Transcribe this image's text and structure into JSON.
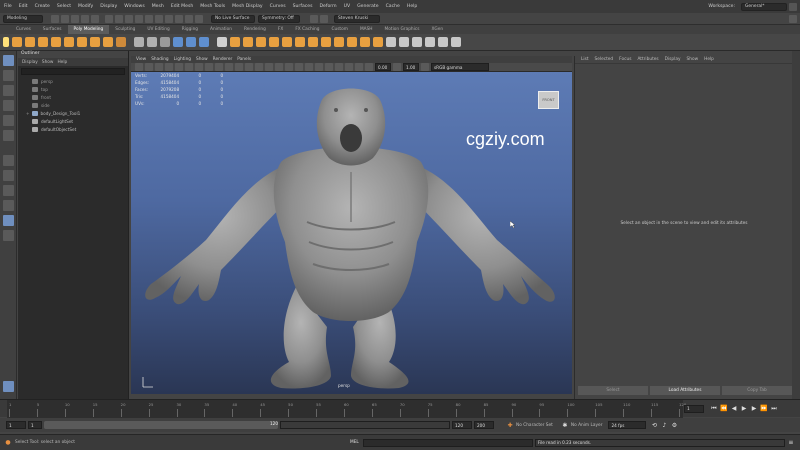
{
  "menubar": {
    "items": [
      "File",
      "Edit",
      "Create",
      "Select",
      "Modify",
      "Display",
      "Windows",
      "Mesh",
      "Edit Mesh",
      "Mesh Tools",
      "Mesh Display",
      "Curves",
      "Surfaces",
      "Deform",
      "UV",
      "Generate",
      "Cache",
      "Help"
    ],
    "workspace_label": "Workspace:",
    "workspace_value": "General*"
  },
  "statusline": {
    "mode": "Modeling",
    "live_surface": "No Live Surface",
    "symmetry": "Symmetry: Off",
    "account": "Steven Kruski"
  },
  "shelf": {
    "tabs": [
      "Curves",
      "Surfaces",
      "Poly Modeling",
      "Sculpting",
      "UV Editing",
      "Rigging",
      "Animation",
      "Rendering",
      "FX",
      "FX Caching",
      "Custom",
      "MASH",
      "Motion Graphics",
      "XGen"
    ],
    "active": "Poly Modeling"
  },
  "outliner": {
    "title": "Outliner",
    "menu": [
      "Display",
      "Show",
      "Help"
    ],
    "items": [
      "persp",
      "top",
      "front",
      "side",
      "body_Design_Tool1",
      "defaultLightSet",
      "defaultObjectSet"
    ]
  },
  "viewport": {
    "menu": [
      "View",
      "Shading",
      "Lighting",
      "Show",
      "Renderer",
      "Panels"
    ],
    "gamma": "0.00",
    "exposure": "1.00",
    "color_space": "sRGB gamma",
    "camera": "persp",
    "watermark": "cgziy.com",
    "viewcube_label": "FRONT",
    "hud": [
      {
        "label": "Verts:",
        "a": "2079404",
        "b": "0",
        "c": "0"
      },
      {
        "label": "Edges:",
        "a": "4158404",
        "b": "0",
        "c": "0"
      },
      {
        "label": "Faces:",
        "a": "2079208",
        "b": "0",
        "c": "0"
      },
      {
        "label": "Tris:",
        "a": "4158404",
        "b": "0",
        "c": "0"
      },
      {
        "label": "UVs:",
        "a": "0",
        "b": "0",
        "c": "0"
      }
    ]
  },
  "attribute_editor": {
    "menu": [
      "List",
      "Selected",
      "Focus",
      "Attributes",
      "Display",
      "Show",
      "Help"
    ],
    "message": "Select an object in the scene to view and edit its attributes",
    "buttons": [
      "Select",
      "Load Attributes",
      "Copy Tab"
    ]
  },
  "timeline": {
    "ticks": [
      "1",
      "5",
      "10",
      "15",
      "20",
      "25",
      "30",
      "35",
      "40",
      "45",
      "50",
      "55",
      "60",
      "65",
      "70",
      "75",
      "80",
      "85",
      "90",
      "95",
      "100",
      "105",
      "110",
      "115",
      "120"
    ],
    "current_frame": "1"
  },
  "range": {
    "start": "1",
    "start_inner": "1",
    "end_inner": "120",
    "end_a": "120",
    "end_b": "200",
    "character_set": "No Character Set",
    "anim_layer": "No Anim Layer",
    "fps": "24 fps"
  },
  "command": {
    "lang": "MEL",
    "help": "Select Tool: select an object",
    "result": "File read in  0.23 seconds."
  }
}
